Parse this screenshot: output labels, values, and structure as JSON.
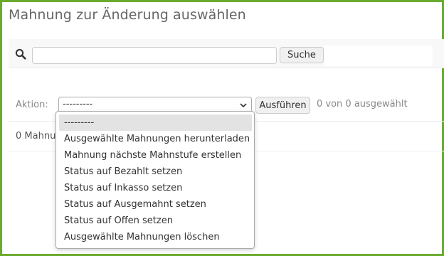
{
  "page": {
    "title": "Mahnung zur Änderung auswählen",
    "accent_color": "#6aab2e"
  },
  "search": {
    "icon": "search-icon",
    "value": "",
    "placeholder": "",
    "button_label": "Suche"
  },
  "actions": {
    "label": "Aktion:",
    "selected_value": "---------",
    "run_label": "Ausführen",
    "selection_count": "0 von 0 ausgewählt",
    "options": [
      "---------",
      "Ausgewählte Mahnungen herunterladen",
      "Mahnung nächste Mahnstufe erstellen",
      "Status auf Bezahlt setzen",
      "Status auf Inkasso setzen",
      "Status auf Ausgemahnt setzen",
      "Status auf Offen setzen",
      "Ausgewählte Mahnungen löschen"
    ]
  },
  "results": {
    "count_text": "0 Mahnungen"
  }
}
